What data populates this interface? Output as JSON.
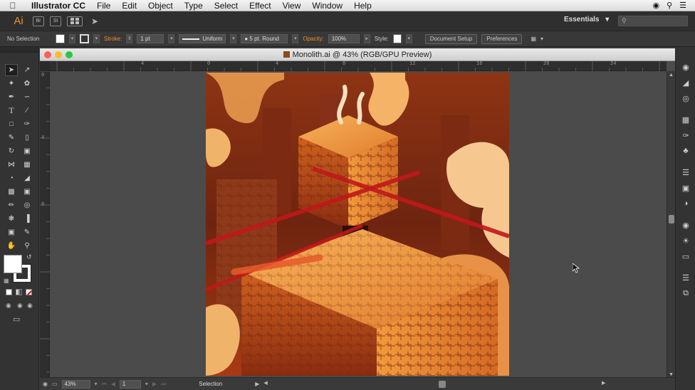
{
  "menubar": {
    "app_name": "Illustrator CC",
    "items": [
      "File",
      "Edit",
      "Object",
      "Type",
      "Select",
      "Effect",
      "View",
      "Window",
      "Help"
    ]
  },
  "appbar": {
    "logo": "Ai",
    "bridge_btn": "Br",
    "stock_btn": "St",
    "workspace": "Essentials",
    "workspace_arrow": "▾"
  },
  "controlbar": {
    "selection_label": "No Selection",
    "stroke_label": "Stroke:",
    "stroke_value": "1 pt",
    "stroke_profile": "Uniform",
    "brush_value": "5 pt. Round",
    "opacity_label": "Opacity:",
    "opacity_value": "100%",
    "style_label": "Style:",
    "document_setup": "Document Setup",
    "preferences": "Preferences"
  },
  "document": {
    "title": "Monolith.ai @ 43% (RGB/GPU Preview)",
    "ruler_h_ticks": [
      "4",
      "0",
      "4",
      "8",
      "12",
      "16",
      "20",
      "24"
    ],
    "ruler_v_ticks": [
      "0",
      "4",
      "8"
    ]
  },
  "statusbar": {
    "zoom": "43%",
    "page": "1",
    "tool": "Selection"
  },
  "colors": {
    "accent": "#e8902e",
    "artwork_bg": "#7a2a10",
    "laser": "#c0181a"
  }
}
